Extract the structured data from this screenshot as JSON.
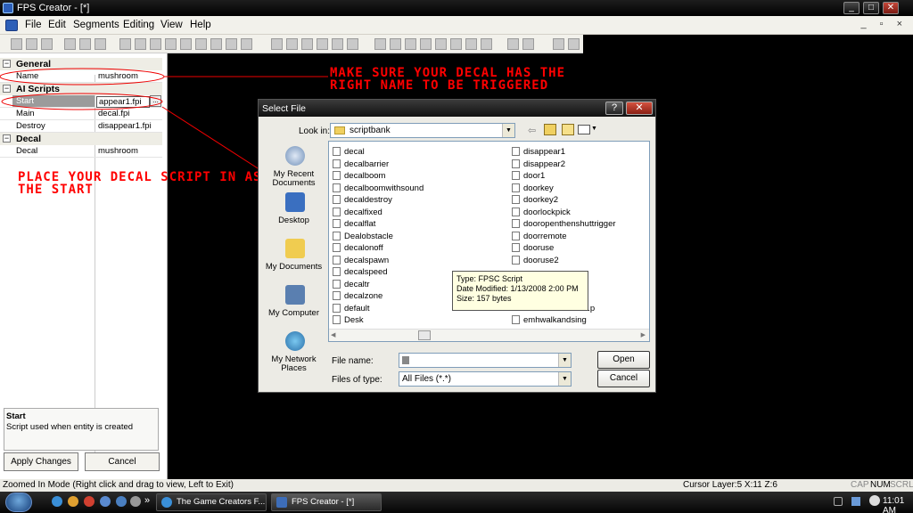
{
  "window": {
    "title": "FPS Creator - [*]",
    "controls": [
      "_",
      "□",
      "✕"
    ]
  },
  "menu": {
    "items": [
      "File",
      "Edit",
      "Segments",
      "Editing",
      "View",
      "Help"
    ],
    "mdi_controls": "_ ▫ ×"
  },
  "left_panel": {
    "groups": [
      {
        "label": "General",
        "rows": [
          {
            "key": "Name",
            "value": "mushroom"
          }
        ]
      },
      {
        "label": "AI Scripts",
        "rows": [
          {
            "key": "Start",
            "value": "appear1.fpi"
          },
          {
            "key": "Main",
            "value": "decal.fpi"
          },
          {
            "key": "Destroy",
            "value": "disappear1.fpi"
          }
        ]
      },
      {
        "label": "Decal",
        "rows": [
          {
            "key": "Decal",
            "value": "mushroom"
          }
        ]
      }
    ],
    "browse_glyph": "...",
    "description": {
      "title": "Start",
      "text": "Script used when entity is created"
    },
    "apply_label": "Apply Changes",
    "cancel_label": "Cancel"
  },
  "annotations": {
    "top": [
      "MAKE SURE YOUR DECAL HAS THE",
      "RIGHT NAME TO BE TRIGGERED"
    ],
    "left": [
      "PLACE YOUR DECAL SCRIPT IN AS",
      "THE START"
    ]
  },
  "dialog": {
    "title": "Select File",
    "help": "?",
    "close": "✕",
    "look_in_label": "Look in:",
    "look_in_value": "scriptbank",
    "places": [
      "My Recent Documents",
      "Desktop",
      "My Documents",
      "My Computer",
      "My Network Places"
    ],
    "files_col1": [
      "decal",
      "decalbarrier",
      "decalboom",
      "decalboomwithsound",
      "decaldestroy",
      "decalfixed",
      "decalflat",
      "Dealobstacle",
      "decalonoff",
      "decalspawn",
      "decalspeed",
      "decaltr",
      "decalzone",
      "default",
      "Desk"
    ],
    "files_col2": [
      "disappear1",
      "disappear2",
      "door1",
      "doorkey",
      "doorkey2",
      "doorlockpick",
      "dooropenthenshuttrigger",
      "doorremote",
      "dooruse",
      "dooruse2",
      "",
      "",
      "",
      "",
      "emhwalkandsing"
    ],
    "files_col2_partial": "...p",
    "tooltip": [
      "Type: FPSC Script",
      "Date Modified: 1/13/2008 2:00 PM",
      "Size: 157 bytes"
    ],
    "file_name_label": "File name:",
    "file_name_value": "",
    "files_of_type_label": "Files of type:",
    "files_of_type_value": "All Files (*.*)",
    "open_label": "Open",
    "cancel_label": "Cancel"
  },
  "status": {
    "mode": "Zoomed In Mode (Right click and drag to view, Left to Exit)",
    "cursor": "Cursor Layer:5  X:11  Z:6",
    "keys": [
      "CAP",
      "NUM",
      "SCRL"
    ]
  },
  "taskbar": {
    "tasks": [
      "The Game Creators F...",
      "FPS Creator - [*]"
    ],
    "overflow": "»",
    "clock": "11:01 AM"
  }
}
